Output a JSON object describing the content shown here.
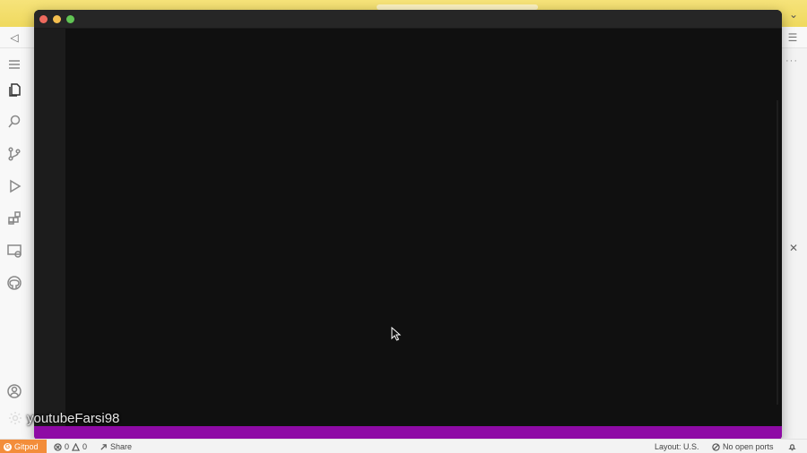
{
  "browser": {
    "chevron_icon": "chevron-down-icon"
  },
  "toolbar": {
    "back_icon": "back-arrow-icon",
    "menu_icon": "menu-lines-icon"
  },
  "activity_bar": {
    "items": [
      {
        "name": "explorer",
        "icon": "files-icon"
      },
      {
        "name": "search",
        "icon": "search-icon"
      },
      {
        "name": "source-control",
        "icon": "source-control-icon"
      },
      {
        "name": "run-debug",
        "icon": "run-debug-icon"
      },
      {
        "name": "extensions",
        "icon": "extensions-icon"
      },
      {
        "name": "remote-explorer",
        "icon": "remote-explorer-icon"
      },
      {
        "name": "github",
        "icon": "github-icon"
      }
    ],
    "bottom_items": [
      {
        "name": "accounts",
        "icon": "account-icon"
      },
      {
        "name": "manage",
        "icon": "gear-icon"
      }
    ]
  },
  "watermark": {
    "text": "youtubeFarsi98"
  },
  "statusbar": {
    "gitpod_label": "Gitpod",
    "errors_count": "0",
    "warnings_count": "0",
    "share_label": "Share",
    "layout_label": "Layout: U.S.",
    "ports_label": "No open ports"
  },
  "colors": {
    "gitpod_orange": "#f38d3a",
    "terminal_bg": "#101010",
    "purple_bar": "#8e0aa5",
    "browser_yellow": "#f6e37a"
  }
}
